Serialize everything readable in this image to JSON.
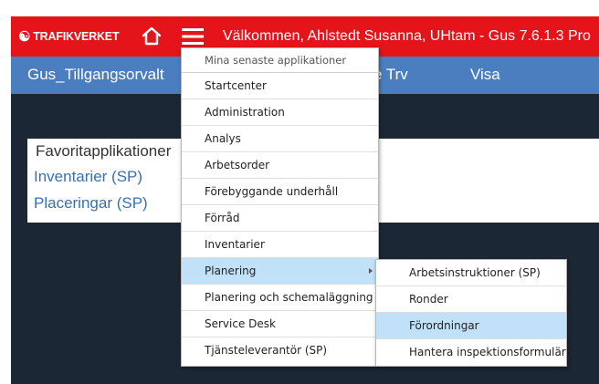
{
  "header": {
    "brand": "TRAFIKVERKET",
    "welcome": "Välkommen, Ahlstedt Susanna, UHtam - Gus 7.6.1.3 Pro"
  },
  "appbar": {
    "app_name": "Gus_Tillgangsorvalt",
    "menu_fragment": "edare Trv",
    "visa": "Visa"
  },
  "favorites": {
    "title": "Favoritapplikationer",
    "links": [
      "Inventarier (SP)",
      "Placeringar (SP)"
    ]
  },
  "dropdown": {
    "header": "Mina senaste applikationer",
    "items": [
      "Startcenter",
      "Administration",
      "Analys",
      "Arbetsorder",
      "Förebyggande underhåll",
      "Förråd",
      "Inventarier",
      "Planering",
      "Planering och schemaläggning",
      "Service Desk",
      "Tjänsteleverantör (SP)"
    ],
    "active_item": "Planering"
  },
  "submenu": {
    "items": [
      "Arbetsinstruktioner (SP)",
      "Ronder",
      "Förordningar",
      "Hantera inspektionsformulär"
    ],
    "highlighted_item": "Förordningar"
  },
  "colors": {
    "header_red": "#e5141b",
    "appbar_blue": "#4a7ebf",
    "background_dark": "#1b2735",
    "link_blue": "#3a6fb0",
    "hover_blue": "#c1e1f8"
  },
  "icons": {
    "logo": "trafikverket-logo-icon",
    "home": "home-icon",
    "menu": "hamburger-icon",
    "submenu_arrow": "chevron-right-icon"
  }
}
